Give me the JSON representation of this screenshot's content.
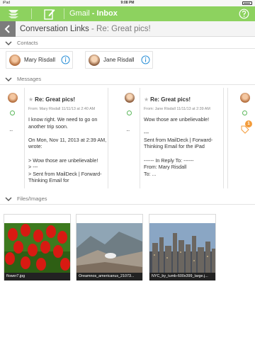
{
  "status_bar": {
    "carrier": "iPad",
    "time": "9:08 PM"
  },
  "app_bar": {
    "title_main": "Gmail",
    "title_separator": " - ",
    "title_folder": "Inbox"
  },
  "conversation": {
    "section": "Conversation Links",
    "separator": " - ",
    "subject": "Re: Great pics!"
  },
  "sections": {
    "contacts": "Contacts",
    "messages": "Messages",
    "files": "Files/Images"
  },
  "contacts": [
    {
      "name": "Mary Risdall"
    },
    {
      "name": "Jane Risdall"
    }
  ],
  "messages": [
    {
      "subject": "Re: Great pics!",
      "from": "From: Mary Risdall 11/11/13 at 2:40 AM",
      "body": "I know right. We need to go on another trip soon.\n\nOn Mon, Nov 11, 2013 at 2:39 AM, wrote:\n\n> Wow those are unbelievable!\n> ---\n> Sent from MailDeck | Forward-Thinking Email for"
    },
    {
      "subject": "Re: Great pics!",
      "from": "From: Jane Risdall 11/11/13 at 2:39 AM",
      "body": "Wow those are unbelievable!\n\n---\nSent from MailDeck | Forward-Thinking Email for the iPad\n\n------ In Reply To: ------\nFrom: Mary Risdall\nTo: ..."
    }
  ],
  "message_more": "...",
  "tag_badge": "1",
  "files": [
    {
      "name": "flower7.jpg"
    },
    {
      "name": "Oreamnos_americanus_21073..."
    },
    {
      "name": "NYC_by_tumb-600x399_large.j..."
    }
  ],
  "colors": {
    "app_bar": "#8dd25f",
    "accent_green": "#5cb85c",
    "back_button": "#7c7c7c",
    "info_blue": "#2a8fd6",
    "badge_orange": "#f39c3b"
  }
}
